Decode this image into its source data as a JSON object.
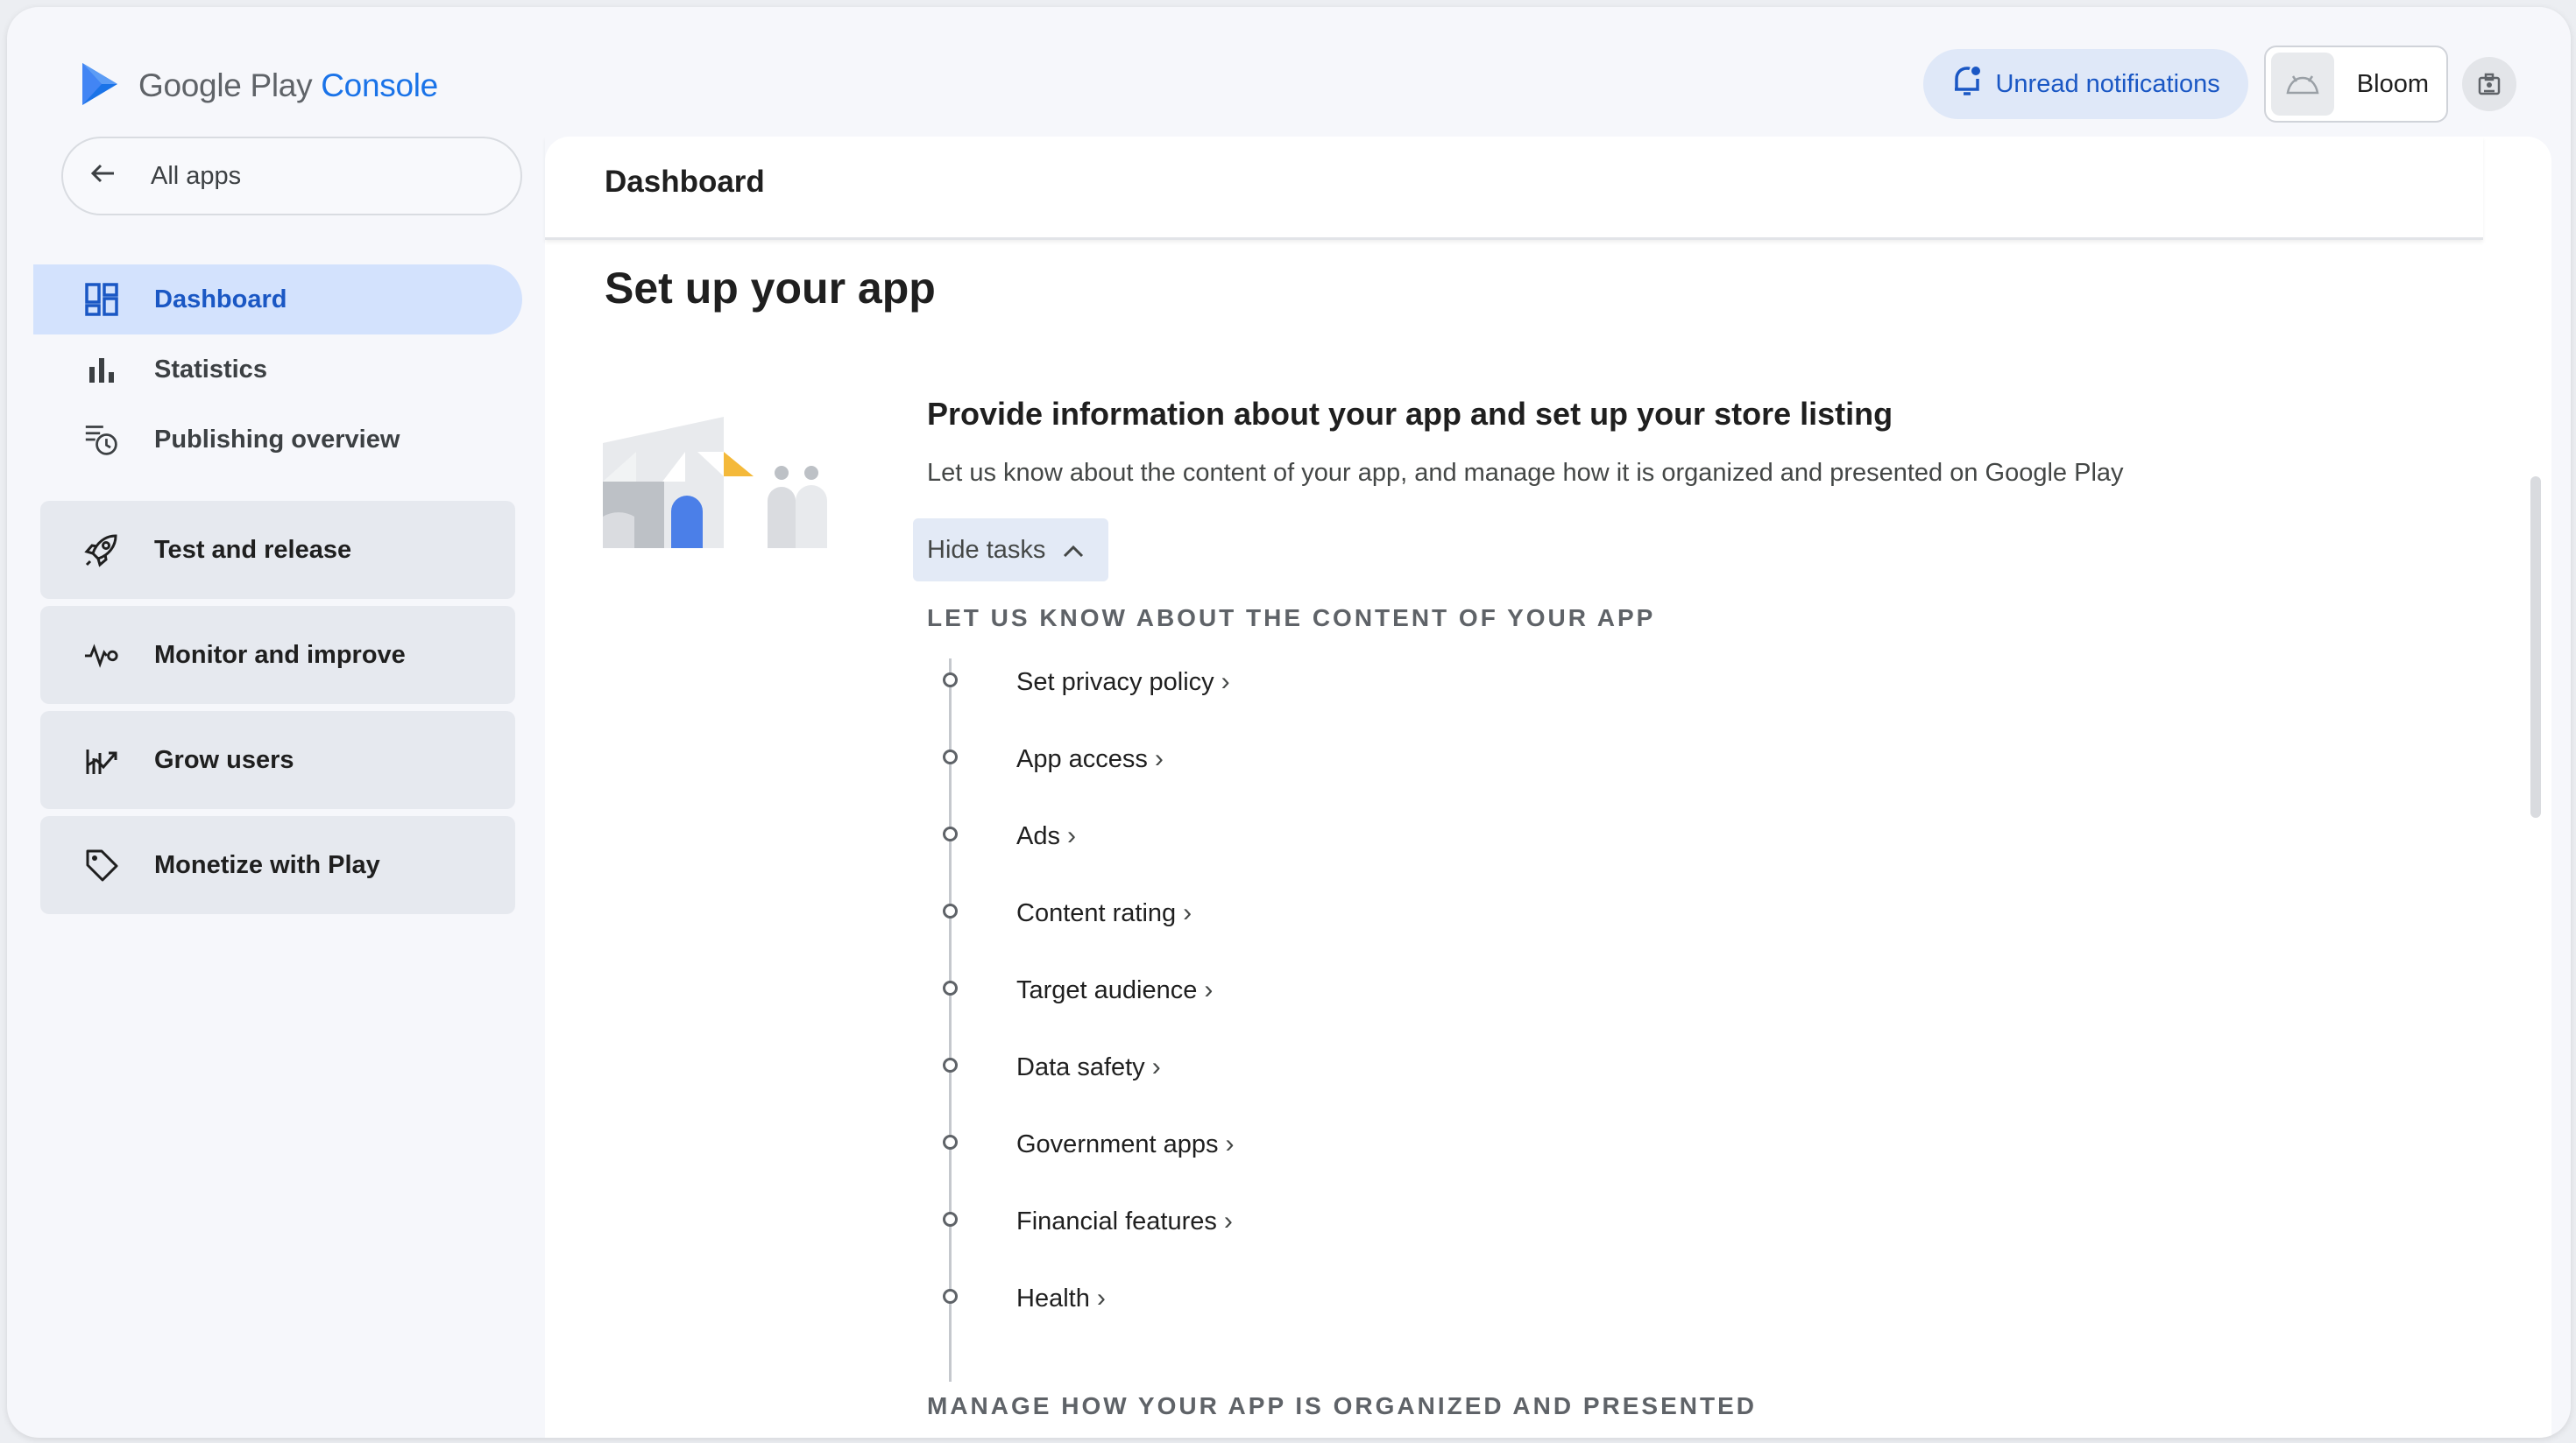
{
  "brand": {
    "name_prefix": "Google Play",
    "name_suffix": "Console",
    "logo_icon": "play-logo"
  },
  "topbar": {
    "notifications_label": "Unread notifications",
    "app_name": "Bloom",
    "icons": [
      "bell-notification-icon",
      "android-icon",
      "profile-card-icon"
    ]
  },
  "sidebar": {
    "all_apps_label": "All apps",
    "nav_items": [
      {
        "label": "Dashboard",
        "icon": "dashboard-icon",
        "active": true
      },
      {
        "label": "Statistics",
        "icon": "bar-chart-icon",
        "active": false
      },
      {
        "label": "Publishing overview",
        "icon": "publishing-clock-icon",
        "active": false
      }
    ],
    "sections": [
      {
        "label": "Test and release",
        "icon": "rocket-icon"
      },
      {
        "label": "Monitor and improve",
        "icon": "pulse-icon"
      },
      {
        "label": "Grow users",
        "icon": "growth-chart-icon"
      },
      {
        "label": "Monetize with Play",
        "icon": "tag-icon"
      }
    ]
  },
  "main": {
    "page_title": "Dashboard",
    "setup_title": "Set up your app",
    "task_card": {
      "title": "Provide information about your app and set up your store listing",
      "description": "Let us know about the content of your app, and manage how it is organized and presented on Google Play",
      "hide_tasks_label": "Hide tasks",
      "group_heading": "LET US KNOW ABOUT THE CONTENT OF YOUR APP",
      "tasks": [
        {
          "label": "Set privacy policy"
        },
        {
          "label": "App access"
        },
        {
          "label": "Ads"
        },
        {
          "label": "Content rating"
        },
        {
          "label": "Target audience"
        },
        {
          "label": "Data safety"
        },
        {
          "label": "Government apps"
        },
        {
          "label": "Financial features"
        },
        {
          "label": "Health"
        }
      ],
      "next_group_heading": "MANAGE HOW YOUR APP IS ORGANIZED AND PRESENTED"
    }
  },
  "colors": {
    "accent": "#1a73e8",
    "active_nav_bg": "#d3e2fd",
    "section_card_bg": "#e6e9ef",
    "notification_bg": "#dfe8f8"
  }
}
